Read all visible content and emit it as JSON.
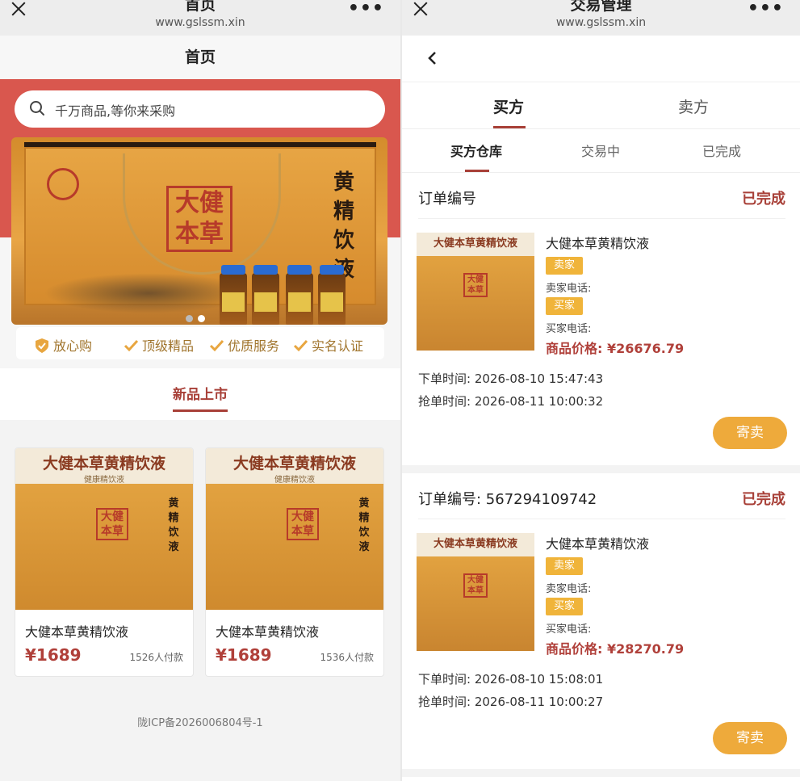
{
  "left": {
    "wx": {
      "title": "首页",
      "url": "www.gslssm.xin",
      "more": "•••"
    },
    "page_title": "首页",
    "search": {
      "placeholder": "千万商品,等你来采购"
    },
    "banner": {
      "stamp": "大健本草",
      "vertical": "黄精饮液"
    },
    "badges": [
      "放心购",
      "顶级精品",
      "优质服务",
      "实名认证"
    ],
    "section_title": "新品上市",
    "products": [
      {
        "img_title": "大健本草黄精饮液",
        "img_sub": "健康精饮液",
        "stamp": "大健本草",
        "vertical": "黄精饮液",
        "name": "大健本草黄精饮液",
        "price": "¥1689",
        "paid": "1526人付款"
      },
      {
        "img_title": "大健本草黄精饮液",
        "img_sub": "健康精饮液",
        "stamp": "大健本草",
        "vertical": "黄精饮液",
        "name": "大健本草黄精饮液",
        "price": "¥1689",
        "paid": "1536人付款"
      }
    ],
    "footer": "陇ICP备2026006804号-1"
  },
  "right": {
    "wx": {
      "title": "交易管理",
      "url": "www.gslssm.xin",
      "more": "•••"
    },
    "tabs": [
      "买方",
      "卖方"
    ],
    "subtabs": [
      "买方仓库",
      "交易中",
      "已完成"
    ],
    "orders": [
      {
        "header": "订单编号",
        "status": "已完成",
        "img_title": "大健本草黄精饮液",
        "stamp": "大健本草",
        "name": "大健本草黄精饮液",
        "seller_tag": "卖家",
        "seller_phone": "卖家电话:",
        "buyer_tag": "买家",
        "buyer_phone": "买家电话:",
        "price": "商品价格: ¥26676.79",
        "order_time": "下单时间: 2026-08-10 15:47:43",
        "grab_time": "抢单时间: 2026-08-11 10:00:32",
        "button": "寄卖"
      },
      {
        "header": "订单编号: 567294109742",
        "status": "已完成",
        "img_title": "大健本草黄精饮液",
        "stamp": "大健本草",
        "name": "大健本草黄精饮液",
        "seller_tag": "卖家",
        "seller_phone": "卖家电话:",
        "buyer_tag": "买家",
        "buyer_phone": "买家电话:",
        "price": "商品价格: ¥28270.79",
        "order_time": "下单时间: 2026-08-10 15:08:01",
        "grab_time": "抢单时间: 2026-08-11 10:00:27",
        "button": "寄卖"
      }
    ]
  },
  "colors": {
    "accent": "#a84038",
    "hero_red": "#d9574e",
    "tag": "#f0b43a",
    "button": "#eeaa3b"
  }
}
